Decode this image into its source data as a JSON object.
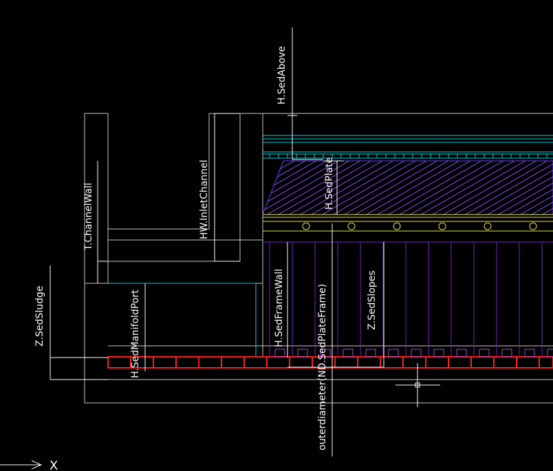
{
  "drawing": {
    "dimension_labels": {
      "h_sed_above": "H.SedAbove",
      "t_channel_wall": "T.ChannelWall",
      "hw_inlet_channel": "HW.InletChannel",
      "h_sed_plate": "H.SedPlate",
      "z_sed_sludge": "Z.SedSludge",
      "h_sed_manifold_port": "H.SedManifoldPort",
      "h_sed_frame_wall": "H.SedFrameWall",
      "outer_diameter": "outerdiameter(ND.SedPlateFrame)",
      "z_sed_slopes": "Z.SedSlopes"
    },
    "ucs_axis_label": "X",
    "colors": {
      "background": "#000000",
      "outline": "#c8c8c8",
      "dimension": "#ffffff",
      "cyan": "#00d8e0",
      "plates": "#7a3cff",
      "support": "#e6e64a",
      "manifold": "#ff2020",
      "purple_lines": "#7a22c8"
    }
  }
}
